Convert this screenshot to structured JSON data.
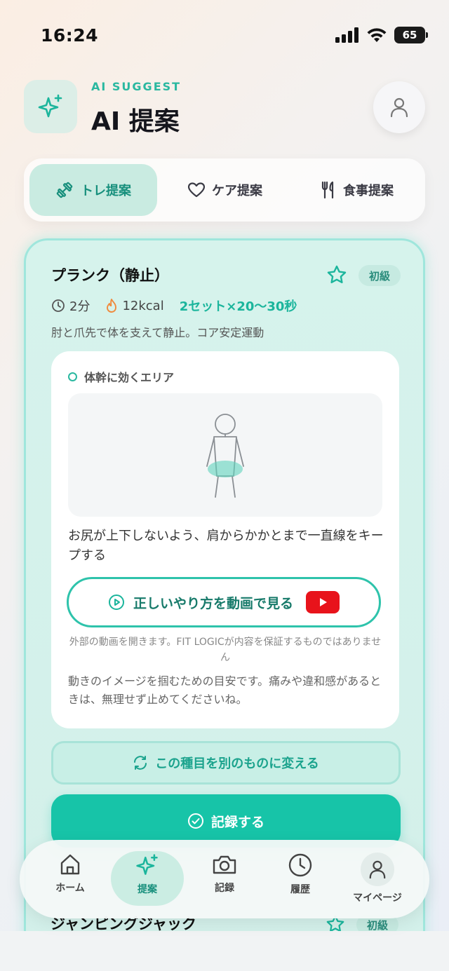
{
  "status_bar": {
    "time": "16:24",
    "battery": "65"
  },
  "header": {
    "subtitle": "AI SUGGEST",
    "title": "AI 提案"
  },
  "tabs": [
    {
      "label": "トレ提案",
      "icon": "dumbbell-icon",
      "active": true
    },
    {
      "label": "ケア提案",
      "icon": "heart-icon",
      "active": false
    },
    {
      "label": "食事提案",
      "icon": "fork-knife-icon",
      "active": false
    }
  ],
  "exercise": {
    "title": "プランク（静止）",
    "level": "初級",
    "duration": "2分",
    "calories": "12kcal",
    "sets": "2セット×20～30秒",
    "description": "肘と爪先で体を支えて静止。コア安定運動",
    "area_label": "体幹に効くエリア",
    "tip": "お尻が上下しないよう、肩からかかとまで一直線をキープする",
    "video_button": "正しいやり方を動画で見る",
    "disclaimer": "外部の動画を開きます。FIT LOGICが内容を保証するものではありません",
    "note": "動きのイメージを掴むための目安です。痛みや違和感があるときは、無理せず止めてくださいね。",
    "swap_button": "この種目を別のものに変える",
    "record_button": "記録する"
  },
  "next_exercise": {
    "title": "ジャンピングジャック",
    "level": "初級"
  },
  "nav": [
    {
      "label": "ホーム",
      "icon": "home-icon"
    },
    {
      "label": "提案",
      "icon": "sparkle-icon",
      "active": true
    },
    {
      "label": "記録",
      "icon": "camera-icon"
    },
    {
      "label": "履歴",
      "icon": "clock-icon"
    },
    {
      "label": "マイページ",
      "icon": "user-icon"
    }
  ],
  "colors": {
    "accent": "#17c4a8",
    "accent_dark": "#178f7c",
    "youtube": "#e8131b"
  }
}
